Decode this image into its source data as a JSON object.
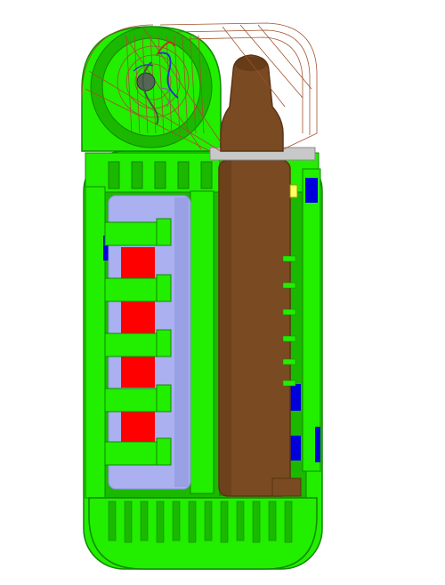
{
  "viewport": {
    "background": "#ffffff",
    "view": "cad-section-view"
  },
  "model": {
    "colors": {
      "housing": "#22ee00",
      "housing_dark": "#1bb800",
      "housing_outline": "#118800",
      "battery_cell": "#aab0f0",
      "battery_cell_shade": "#8a90d8",
      "battery_core": "#ff0000",
      "heater_tube": "#7a4a22",
      "heater_tube_dark": "#5a3414",
      "wireframe": "#a0522d",
      "accent_blue": "#0000dd",
      "tray": "#c8c8c8",
      "contact": "#ffff66"
    },
    "parts": [
      "outer-housing",
      "battery-cell",
      "battery-clips",
      "heater-tube",
      "heater-cap",
      "lid-wireframe",
      "hinge-assembly",
      "internal-ribs",
      "base-vents"
    ],
    "battery_segments": 4,
    "rib_count": 6,
    "base_vent_count": 12
  }
}
